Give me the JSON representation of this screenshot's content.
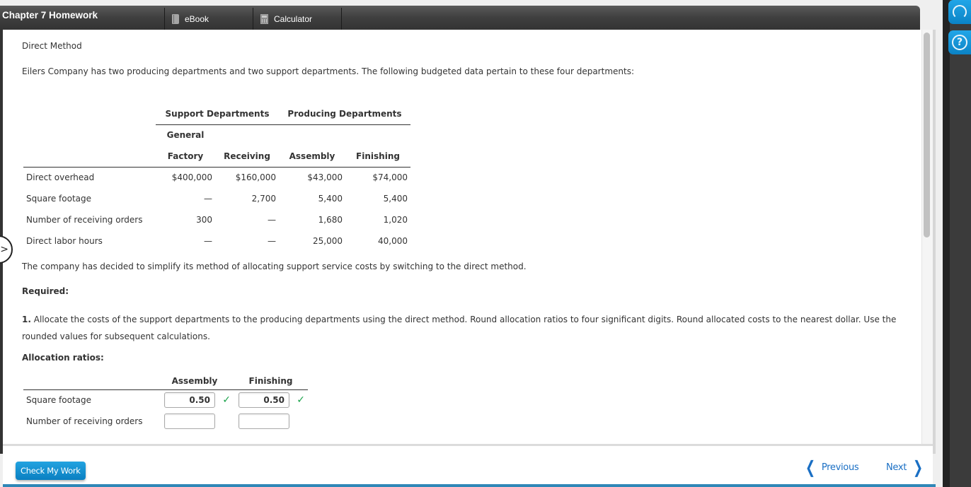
{
  "header": {
    "title": "Chapter 7 Homework",
    "tabs": [
      {
        "label": "eBook",
        "icon": "book-icon"
      },
      {
        "label": "Calculator",
        "icon": "calculator-icon"
      }
    ]
  },
  "content": {
    "section_title": "Direct Method",
    "intro": "Eilers Company has two producing departments and two support departments. The following budgeted data pertain to these four departments:",
    "budget_table": {
      "group_headers": [
        "Support Departments",
        "Producing Departments"
      ],
      "sub_header_top": "General",
      "columns": [
        "Factory",
        "Receiving",
        "Assembly",
        "Finishing"
      ],
      "rows": [
        {
          "label": "Direct overhead",
          "values": [
            "$400,000",
            "$160,000",
            "$43,000",
            "$74,000"
          ]
        },
        {
          "label": "Square footage",
          "values": [
            "—",
            "2,700",
            "5,400",
            "5,400"
          ]
        },
        {
          "label": "Number of receiving orders",
          "values": [
            "300",
            "—",
            "1,680",
            "1,020"
          ]
        },
        {
          "label": "Direct labor hours",
          "values": [
            "—",
            "—",
            "25,000",
            "40,000"
          ]
        }
      ]
    },
    "note": "The company has decided to simplify its method of allocating support service costs by switching to the direct method.",
    "required_label": "Required:",
    "instruction_number": "1.",
    "instruction": " Allocate the costs of the support departments to the producing departments using the direct method. Round allocation ratios to four significant digits. Round allocated costs to the nearest dollar. Use the rounded values for subsequent calculations.",
    "allocation_title": "Allocation ratios:",
    "allocation_table": {
      "columns": [
        "Assembly",
        "Finishing"
      ],
      "rows": [
        {
          "label": "Square footage",
          "assembly": "0.50",
          "finishing": "0.50",
          "assembly_correct": true,
          "finishing_correct": true
        },
        {
          "label": "Number of receiving orders",
          "assembly": "",
          "finishing": "",
          "assembly_correct": false,
          "finishing_correct": false
        }
      ]
    }
  },
  "footer": {
    "check_button": "Check My Work",
    "previous": "Previous",
    "next": "Next"
  },
  "colors": {
    "accent_blue": "#0a7fc1",
    "link_blue": "#1a6fc4",
    "correct_green": "#1aa34a",
    "header_dark": "#3f3f3f"
  },
  "rail": {
    "support_icon": "headset-icon",
    "help_icon": "help-icon",
    "help_glyph": "?"
  }
}
